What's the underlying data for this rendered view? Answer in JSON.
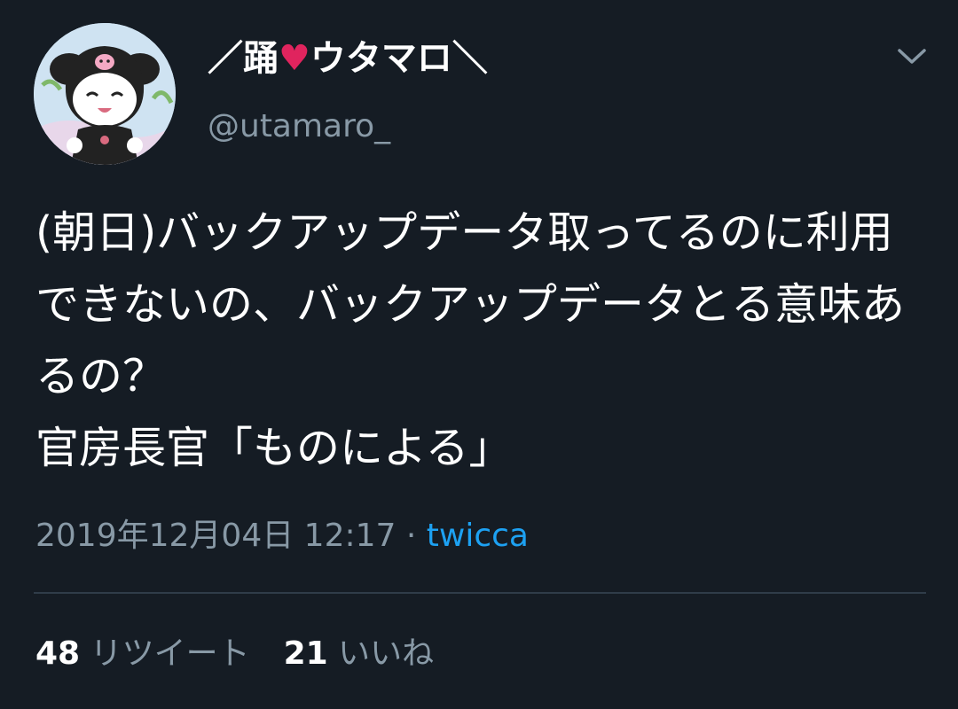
{
  "tweet": {
    "display_name_prefix": "／踊",
    "display_name_heart": "♥",
    "display_name_suffix": "ウタマロ＼",
    "handle": "@utamaro_",
    "text": "(朝日)バックアップデータ取ってるのに利用できないの、バックアップデータとる意味あるの？\n官房長官「ものによる」",
    "date": "2019年12月04日 12:17",
    "separator": " · ",
    "source": "twicca",
    "retweet_count": "48",
    "retweet_label": "リツイート",
    "like_count": "21",
    "like_label": "いいね"
  },
  "icons": {
    "avatar": "avatar-image",
    "menu": "chevron-down-icon"
  },
  "colors": {
    "background": "#151c24",
    "text": "#ffffff",
    "secondary": "#8899a6",
    "link": "#1da1f2",
    "heart": "#e0245e",
    "divider": "#2f3c49"
  }
}
